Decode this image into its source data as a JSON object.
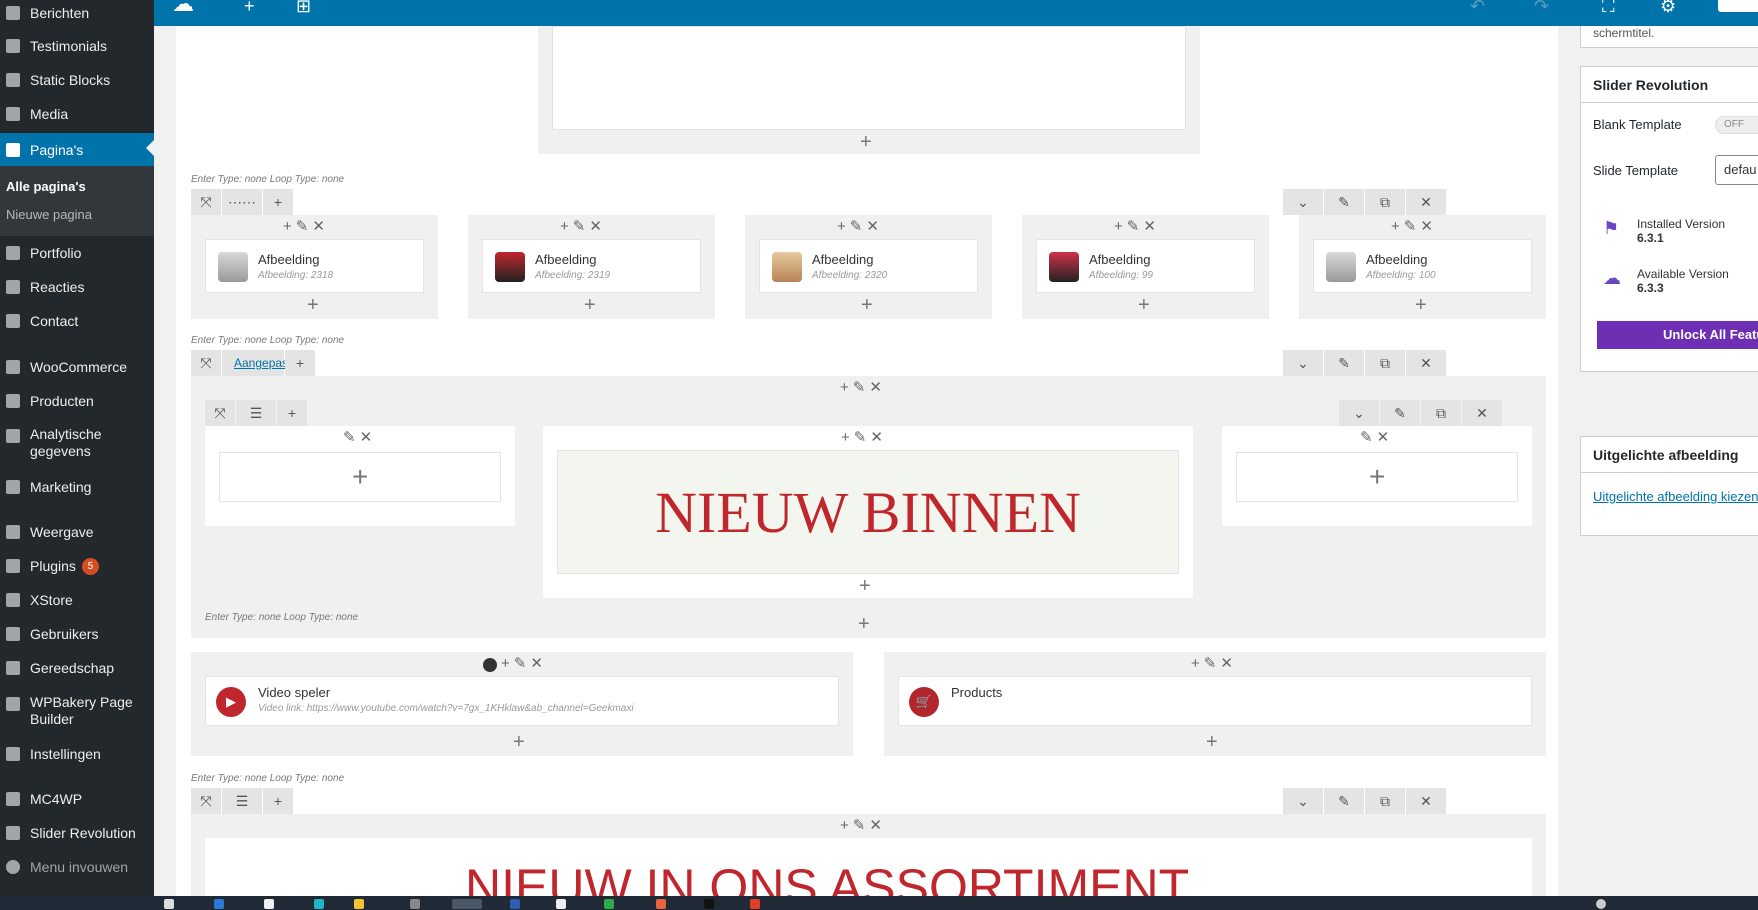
{
  "sidebar": {
    "items": [
      {
        "label": "Berichten",
        "icon": "pin-icon"
      },
      {
        "label": "Testimonials",
        "icon": "comment-icon"
      },
      {
        "label": "Static Blocks",
        "icon": "block-icon"
      },
      {
        "label": "Media",
        "icon": "media-icon"
      },
      {
        "label": "Pagina's",
        "icon": "page-icon"
      },
      {
        "label": "Portfolio",
        "icon": "portfolio-icon"
      },
      {
        "label": "Reacties",
        "icon": "comments-icon"
      },
      {
        "label": "Contact",
        "icon": "mail-icon"
      },
      {
        "label": "WooCommerce",
        "icon": "woo-icon"
      },
      {
        "label": "Producten",
        "icon": "box-icon"
      },
      {
        "label": "Analytische gegevens",
        "icon": "chart-icon"
      },
      {
        "label": "Marketing",
        "icon": "megaphone-icon"
      },
      {
        "label": "Weergave",
        "icon": "brush-icon"
      },
      {
        "label": "Plugins",
        "icon": "plug-icon",
        "badge": "5"
      },
      {
        "label": "XStore",
        "icon": "x-icon"
      },
      {
        "label": "Gebruikers",
        "icon": "user-icon"
      },
      {
        "label": "Gereedschap",
        "icon": "wrench-icon"
      },
      {
        "label": "WPBakery Page Builder",
        "icon": "bakery-icon"
      },
      {
        "label": "Instellingen",
        "icon": "settings-icon"
      },
      {
        "label": "MC4WP",
        "icon": "mc4wp-icon"
      },
      {
        "label": "Slider Revolution",
        "icon": "refresh-icon"
      },
      {
        "label": "Menu invouwen",
        "icon": "collapse-icon"
      }
    ],
    "submenu": [
      "Alle pagina's",
      "Nieuwe pagina"
    ]
  },
  "builder": {
    "meta_text": "Enter Type: none  Loop Type: none",
    "custom_label": "Aangepaste",
    "images": [
      {
        "title": "Afbeelding",
        "sub": "Afbeelding: 2318"
      },
      {
        "title": "Afbeelding",
        "sub": "Afbeelding: 2319"
      },
      {
        "title": "Afbeelding",
        "sub": "Afbeelding: 2320"
      },
      {
        "title": "Afbeelding",
        "sub": "Afbeelding: 99"
      },
      {
        "title": "Afbeelding",
        "sub": "Afbeelding: 100"
      }
    ],
    "banner_text": "NIEUW BINNEN",
    "video": {
      "title": "Video speler",
      "sub": "Video link: https://www.youtube.com/watch?v=7gx_1KHklaw&ab_channel=Geekmaxi"
    },
    "products": {
      "title": "Products"
    },
    "bottom_banner_text": "NIEUW IN ONS ASSORTIMENT"
  },
  "right_panel": {
    "top_fragment": "schermtitel.",
    "slider_revolution": {
      "title": "Slider Revolution",
      "blank_template_label": "Blank Template",
      "blank_template_value": "OFF",
      "slide_template_label": "Slide Template",
      "slide_template_value": "defau",
      "installed_label": "Installed Version",
      "installed_value": "6.3.1",
      "available_label": "Available Version",
      "available_value": "6.3.3",
      "unlock_button": "Unlock All Featu"
    },
    "featured_image": {
      "title": "Uitgelichte afbeelding",
      "link": "Uitgelichte afbeelding kiezen"
    }
  },
  "colors": {
    "sidebar": "#23282d",
    "accent": "#0073aa",
    "banner_red": "#c0272d",
    "purple": "#6e2fb4"
  }
}
